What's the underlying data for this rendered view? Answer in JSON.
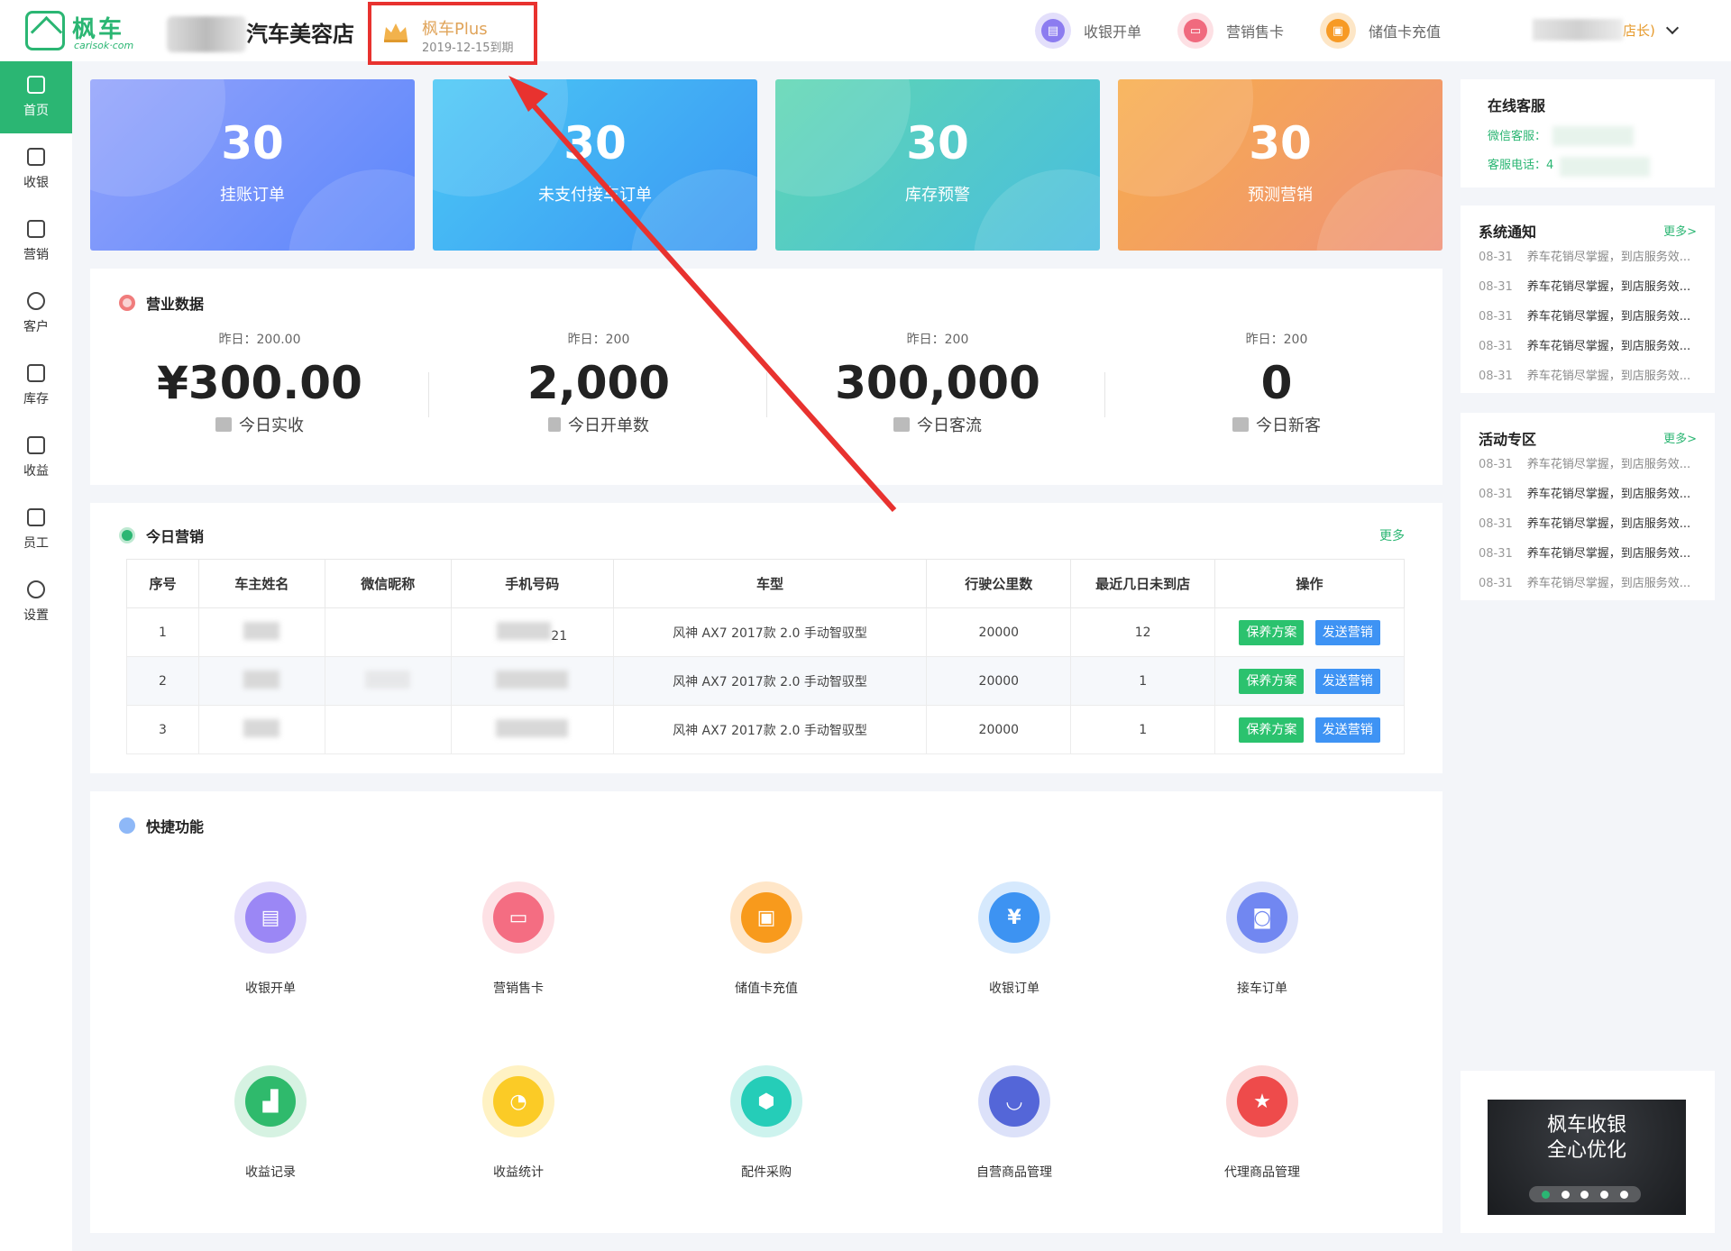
{
  "header": {
    "logo_text": "枫车",
    "logo_sub": "carisok·com",
    "shop_name": "汽车美容店",
    "plus": {
      "title": "枫车Plus",
      "expire": "2019-12-15到期"
    },
    "actions": [
      {
        "label": "收银开单",
        "icon": "cash-register-icon",
        "color": "#8c7cf0"
      },
      {
        "label": "营销售卡",
        "icon": "card-icon",
        "color": "#f06a7e"
      },
      {
        "label": "储值卡充值",
        "icon": "wallet-icon",
        "color": "#f79a24"
      }
    ],
    "user_role": "店长)"
  },
  "sidebar": {
    "items": [
      {
        "label": "首页",
        "icon": "home-icon",
        "active": true
      },
      {
        "label": "收银",
        "icon": "yen-icon"
      },
      {
        "label": "营销",
        "icon": "ticket-icon"
      },
      {
        "label": "客户",
        "icon": "user-icon"
      },
      {
        "label": "库存",
        "icon": "box-icon"
      },
      {
        "label": "收益",
        "icon": "chart-icon"
      },
      {
        "label": "员工",
        "icon": "staff-icon"
      },
      {
        "label": "设置",
        "icon": "gear-icon"
      }
    ]
  },
  "stats": [
    {
      "value": "30",
      "label": "挂账订单",
      "from": "#93a3fb",
      "to": "#5b86fb"
    },
    {
      "value": "30",
      "label": "未支付接车订单",
      "from": "#4bc8f5",
      "to": "#3a96f3"
    },
    {
      "value": "30",
      "label": "库存预警",
      "from": "#5fd6b2",
      "to": "#48bde0"
    },
    {
      "value": "30",
      "label": "预测营销",
      "from": "#f7ad4c",
      "to": "#ef9178"
    }
  ],
  "business": {
    "title": "营业数据",
    "items": [
      {
        "yesterday": "昨日：200.00",
        "value": "¥300.00",
        "label": "今日实收"
      },
      {
        "yesterday": "昨日：200",
        "value": "2,000",
        "label": "今日开单数"
      },
      {
        "yesterday": "昨日：200",
        "value": "300,000",
        "label": "今日客流"
      },
      {
        "yesterday": "昨日：200",
        "value": "0",
        "label": "今日新客"
      }
    ]
  },
  "marketing": {
    "title": "今日营销",
    "more": "更多",
    "columns": [
      "序号",
      "车主姓名",
      "微信昵称",
      "手机号码",
      "车型",
      "行驶公里数",
      "最近几日未到店",
      "操作"
    ],
    "rows": [
      {
        "no": "1",
        "phone_tail": "21",
        "model": "风神 AX7 2017款 2.0 手动智驭型",
        "km": "20000",
        "days": "12"
      },
      {
        "no": "2",
        "phone_tail": "",
        "model": "风神 AX7 2017款 2.0 手动智驭型",
        "km": "20000",
        "days": "1"
      },
      {
        "no": "3",
        "phone_tail": "",
        "model": "风神 AX7 2017款 2.0 手动智驭型",
        "km": "20000",
        "days": "1"
      }
    ],
    "btn_plan": "保养方案",
    "btn_send": "发送营销"
  },
  "quick": {
    "title": "快捷功能",
    "items": [
      {
        "label": "收银开单",
        "icon": "cash-register-icon",
        "ring": "#e5e0fb",
        "core": "#9b87f5"
      },
      {
        "label": "营销售卡",
        "icon": "card-icon",
        "ring": "#fde1e5",
        "core": "#f46d82"
      },
      {
        "label": "储值卡充值",
        "icon": "wallet-icon",
        "ring": "#ffe6c8",
        "core": "#f89a1c"
      },
      {
        "label": "收银订单",
        "icon": "monitor-yen-icon",
        "ring": "#d6e9fd",
        "core": "#3d93f2"
      },
      {
        "label": "接车订单",
        "icon": "car-icon",
        "ring": "#dfe4fb",
        "core": "#7187f1"
      },
      {
        "label": "收益记录",
        "icon": "growth-chart-icon",
        "ring": "#d6f2e2",
        "core": "#2fba6c"
      },
      {
        "label": "收益统计",
        "icon": "pie-chart-icon",
        "ring": "#fff2c4",
        "core": "#fbcb26"
      },
      {
        "label": "配件采购",
        "icon": "hexagon-icon",
        "ring": "#cdf3ee",
        "core": "#25cdb8"
      },
      {
        "label": "自营商品管理",
        "icon": "bag-icon",
        "ring": "#dce1f9",
        "core": "#5466d8"
      },
      {
        "label": "代理商品管理",
        "icon": "star-bag-icon",
        "ring": "#fcdada",
        "core": "#ee4b4b"
      }
    ]
  },
  "customer_service": {
    "title": "在线客服",
    "wechat": "微信客服：",
    "phone": "客服电话：4"
  },
  "notices": {
    "title": "系统通知",
    "more": "更多>",
    "rows": [
      {
        "date": "08-31",
        "text": "养车花销尽掌握，到店服务效...",
        "read": true
      },
      {
        "date": "08-31",
        "text": "养车花销尽掌握，到店服务效...",
        "read": false
      },
      {
        "date": "08-31",
        "text": "养车花销尽掌握，到店服务效...",
        "read": false
      },
      {
        "date": "08-31",
        "text": "养车花销尽掌握，到店服务效...",
        "read": false
      },
      {
        "date": "08-31",
        "text": "养车花销尽掌握，到店服务效...",
        "read": true
      }
    ]
  },
  "activities": {
    "title": "活动专区",
    "more": "更多>",
    "rows": [
      {
        "date": "08-31",
        "text": "养车花销尽掌握，到店服务效...",
        "read": true
      },
      {
        "date": "08-31",
        "text": "养车花销尽掌握，到店服务效...",
        "read": false
      },
      {
        "date": "08-31",
        "text": "养车花销尽掌握，到店服务效...",
        "read": false
      },
      {
        "date": "08-31",
        "text": "养车花销尽掌握，到店服务效...",
        "read": false
      },
      {
        "date": "08-31",
        "text": "养车花销尽掌握，到店服务效...",
        "read": true
      }
    ]
  },
  "banner": {
    "line1": "枫车收银",
    "line2": "全心优化"
  }
}
